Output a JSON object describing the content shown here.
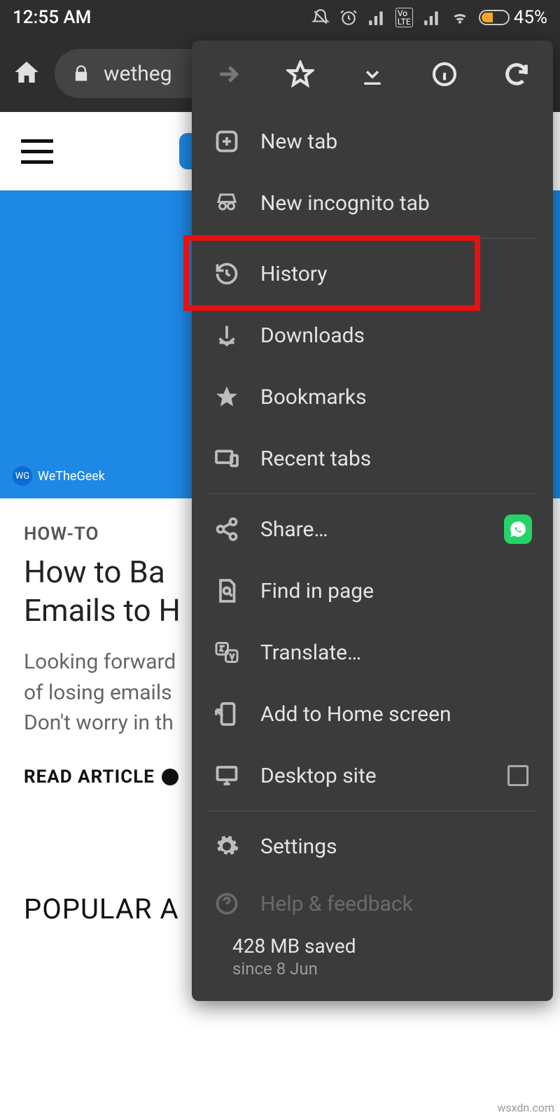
{
  "status": {
    "time": "12:55 AM",
    "battery": "45%"
  },
  "toolbar": {
    "url": "wetheg"
  },
  "page": {
    "brand": "WeTheGeek",
    "category": "HOW-TO",
    "title_line1": "How to Ba",
    "title_line2": "Emails to H",
    "excerpt_line1": "Looking forward",
    "excerpt_line2": "of losing emails",
    "excerpt_line3": "Don't worry in th",
    "read_label": "READ ARTICLE",
    "section": "POPULAR A"
  },
  "menu": {
    "items": [
      {
        "id": "new-tab",
        "label": "New tab"
      },
      {
        "id": "incognito",
        "label": "New incognito tab"
      },
      {
        "id": "history",
        "label": "History"
      },
      {
        "id": "downloads",
        "label": "Downloads"
      },
      {
        "id": "bookmarks",
        "label": "Bookmarks"
      },
      {
        "id": "recent-tabs",
        "label": "Recent tabs"
      },
      {
        "id": "share",
        "label": "Share…"
      },
      {
        "id": "find",
        "label": "Find in page"
      },
      {
        "id": "translate",
        "label": "Translate…"
      },
      {
        "id": "add-home",
        "label": "Add to Home screen"
      },
      {
        "id": "desktop",
        "label": "Desktop site"
      },
      {
        "id": "settings",
        "label": "Settings"
      },
      {
        "id": "help",
        "label": "Help & feedback"
      }
    ],
    "data_saved": {
      "main": "428 MB saved",
      "sub": "since 8 Jun"
    }
  },
  "watermark": "wsxdn.com"
}
